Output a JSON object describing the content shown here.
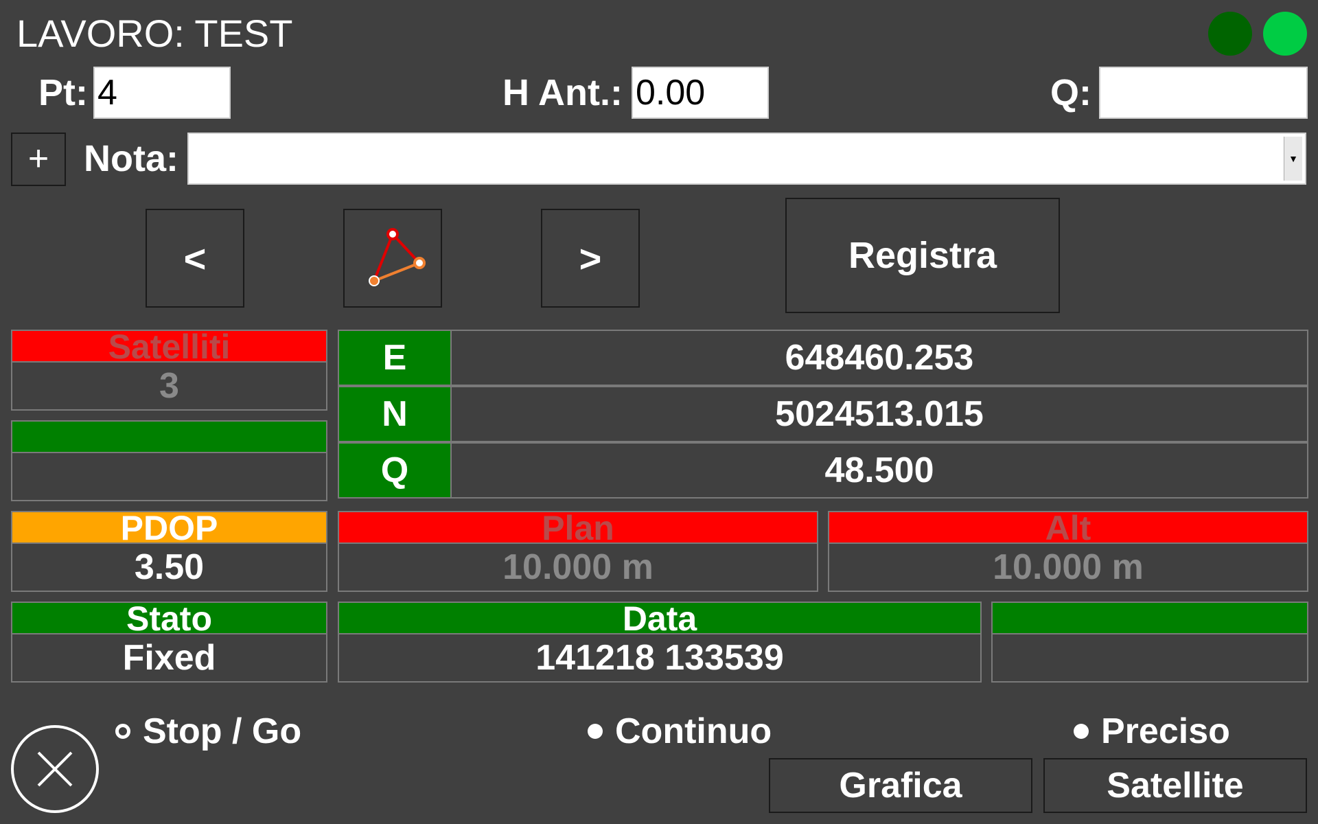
{
  "header": {
    "title": "LAVORO: TEST",
    "status_leds": [
      {
        "name": "led-dark-green",
        "color": "#006400"
      },
      {
        "name": "led-bright-green",
        "color": "#00cc44"
      }
    ]
  },
  "fields": {
    "pt_label": "Pt:",
    "pt_value": "4",
    "hant_label": "H Ant.:",
    "hant_value": "0.00",
    "q_label": "Q:",
    "q_value": "",
    "nota_label": "Nota:",
    "nota_value": ""
  },
  "toolbar": {
    "plus_label": "+",
    "prev_label": "<",
    "next_label": ">",
    "polygon_icon": "polygon-icon",
    "registra_label": "Registra"
  },
  "status": {
    "satelliti": {
      "label": "Satelliti",
      "value": "3",
      "color": "#ff0000"
    },
    "blank_green": {
      "label": "",
      "value": "",
      "color": "#008000"
    },
    "pdop": {
      "label": "PDOP",
      "value": "3.50",
      "color": "#ffa500"
    },
    "stato": {
      "label": "Stato",
      "value": "Fixed",
      "color": "#008000"
    },
    "plan": {
      "label": "Plan",
      "value": "10.000 m",
      "color": "#ff0000"
    },
    "alt": {
      "label": "Alt",
      "value": "10.000 m",
      "color": "#ff0000"
    },
    "data": {
      "label": "Data",
      "value": "141218 133539",
      "color": "#008000"
    },
    "blank_green2": {
      "label": "",
      "value": "",
      "color": "#008000"
    }
  },
  "coordinates": [
    {
      "label": "E",
      "value": "648460.253"
    },
    {
      "label": "N",
      "value": "5024513.015"
    },
    {
      "label": "Q",
      "value": "48.500"
    }
  ],
  "modes": {
    "options": [
      {
        "label": "Stop / Go",
        "selected": true
      },
      {
        "label": "Continuo",
        "selected": false
      },
      {
        "label": "Preciso",
        "selected": false
      }
    ]
  },
  "footer": {
    "close_icon": "close-icon",
    "grafica_label": "Grafica",
    "satellite_label": "Satellite"
  }
}
